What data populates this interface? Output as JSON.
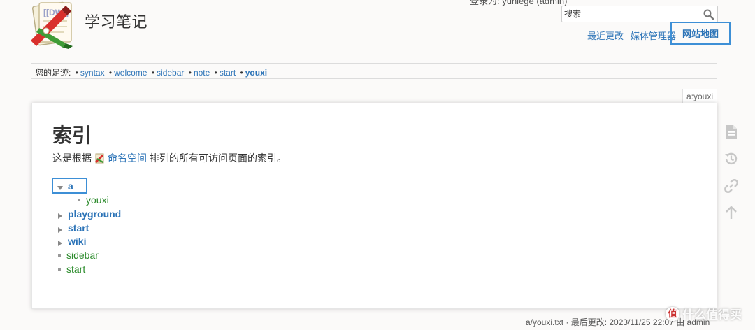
{
  "header": {
    "site_title": "学习笔记",
    "user_line": "登录为: yuniege (admin)",
    "search": {
      "placeholder": "搜索"
    },
    "site_tools": {
      "recent_changes": "最近更改",
      "media_manager": "媒体管理器",
      "sitemap": "网站地图"
    }
  },
  "breadcrumbs": {
    "label": "您的足迹:",
    "items": [
      "syntax",
      "welcome",
      "sidebar",
      "note",
      "start"
    ],
    "current": "youxi"
  },
  "page_id": "a:youxi",
  "content": {
    "heading": "索引",
    "intro_before": "这是根据",
    "intro_link": "命名空间",
    "intro_after": "排列的所有可访问页面的索引。",
    "index": [
      {
        "label": "a",
        "kind": "namespace-open"
      },
      {
        "label": "youxi",
        "kind": "page"
      },
      {
        "label": "playground",
        "kind": "namespace-closed"
      },
      {
        "label": "start",
        "kind": "namespace-closed"
      },
      {
        "label": "wiki",
        "kind": "namespace-closed"
      },
      {
        "label": "sidebar",
        "kind": "page"
      },
      {
        "label": "start",
        "kind": "page"
      }
    ]
  },
  "page_tools": [
    "show-page-icon",
    "old-revisions-icon",
    "backlinks-icon",
    "back-to-top-icon"
  ],
  "footer": {
    "doc_info": "a/youxi.txt · 最后更改: 2023/11/25 22:07 由 admin"
  },
  "watermark": {
    "badge": "值",
    "text": "什么值得买"
  },
  "colors": {
    "link": "#2b73b7",
    "existing_page": "#2a8a2a",
    "highlight_box": "#3d8fd6"
  }
}
